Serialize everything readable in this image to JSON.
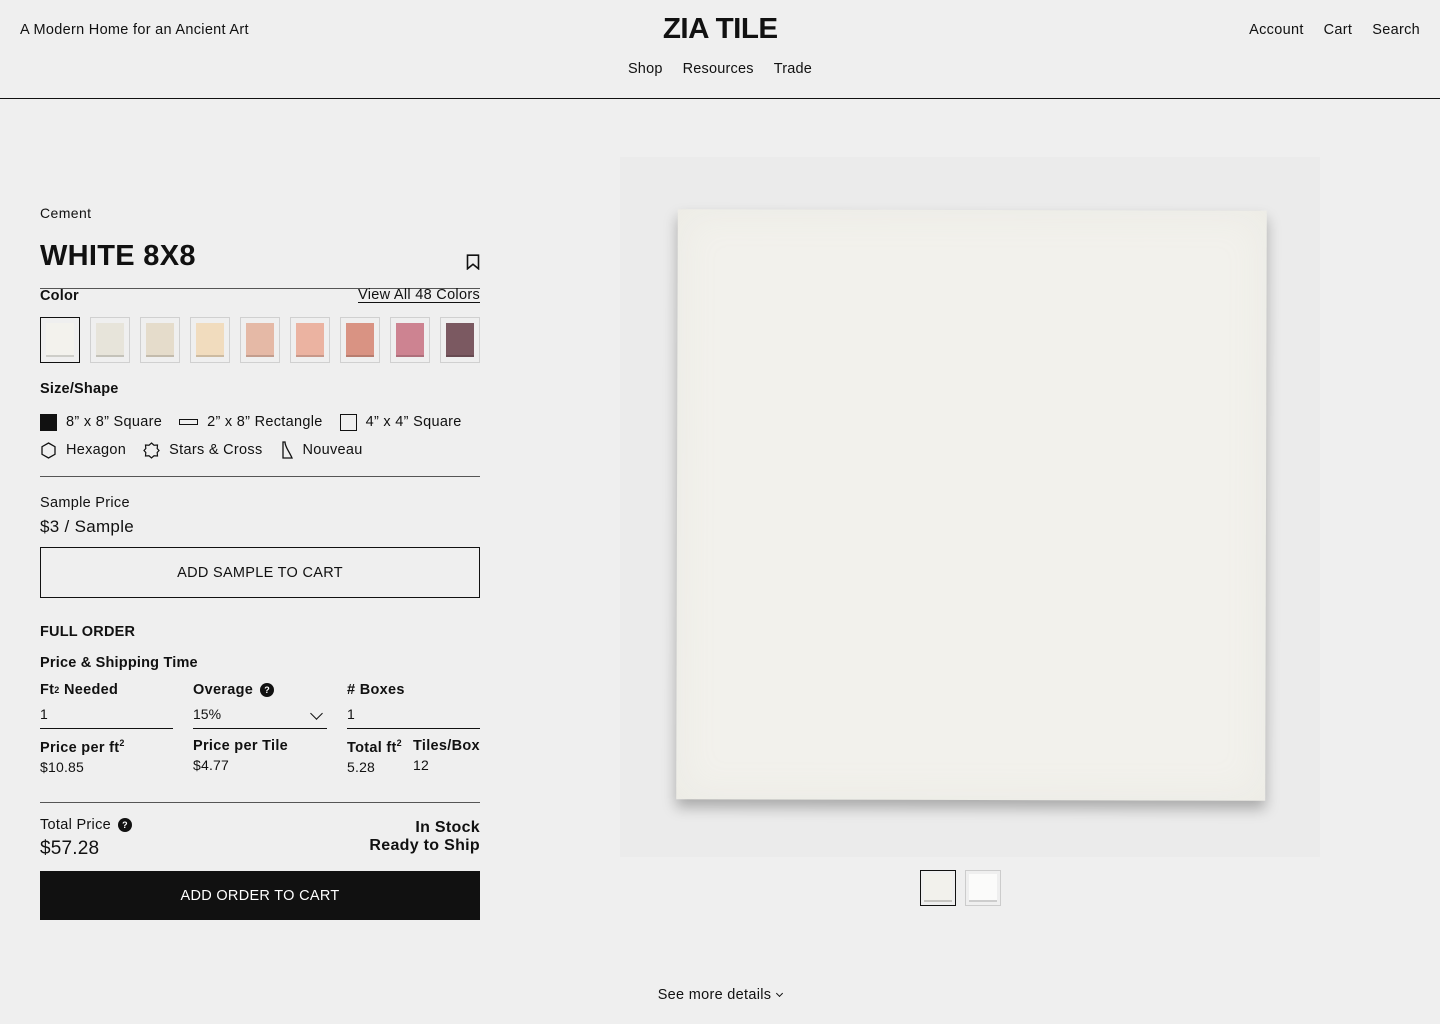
{
  "header": {
    "tagline": "A Modern Home for an Ancient Art",
    "logo": "ZIA TILE",
    "account": "Account",
    "cart": "Cart",
    "search": "Search",
    "nav": [
      "Shop",
      "Resources",
      "Trade"
    ]
  },
  "product": {
    "category": "Cement",
    "title": "WHITE 8X8",
    "bookmark_icon": "bookmark-icon"
  },
  "color": {
    "label": "Color",
    "view_all": "View All 48 Colors",
    "swatches": [
      "#f3f2ed",
      "#e7e4da",
      "#e5dccb",
      "#f1dcbe",
      "#e5b9a6",
      "#ebb3a1",
      "#d99383",
      "#cd8391",
      "#7b5961"
    ]
  },
  "size": {
    "label": "Size/Shape",
    "shapes": [
      "8” x 8” Square",
      "2” x 8” Rectangle",
      "4” x 4” Square",
      "Hexagon",
      "Stars & Cross",
      "Nouveau"
    ]
  },
  "sample": {
    "label": "Sample Price",
    "price": "$3 / Sample",
    "button": "ADD SAMPLE TO CART"
  },
  "order": {
    "heading": "FULL ORDER",
    "subheading": "Price & Shipping Time",
    "ft_needed_label": "Ft",
    "ft_needed_sup": "2",
    "ft_needed_suffix": " Needed",
    "ft_needed_value": "1",
    "overage_label": "Overage",
    "overage_value": "15%",
    "boxes_label": "# Boxes",
    "boxes_value": "1",
    "price_per_ft_label": "Price per ft",
    "price_per_ft_sup": "2",
    "price_per_ft": "$10.85",
    "price_per_tile_label": "Price per Tile",
    "price_per_tile": "$4.77",
    "total_ft_label": "Total ft",
    "total_ft_sup": "2",
    "total_ft": "5.28",
    "tiles_box_label": "Tiles/Box",
    "tiles_box": "12",
    "total_label": "Total Price",
    "total_price": "$57.28",
    "stock": "In Stock",
    "ship": "Ready to Ship",
    "button": "ADD ORDER TO CART"
  },
  "help_glyph": "?",
  "footer": {
    "see_more": "See more details"
  }
}
